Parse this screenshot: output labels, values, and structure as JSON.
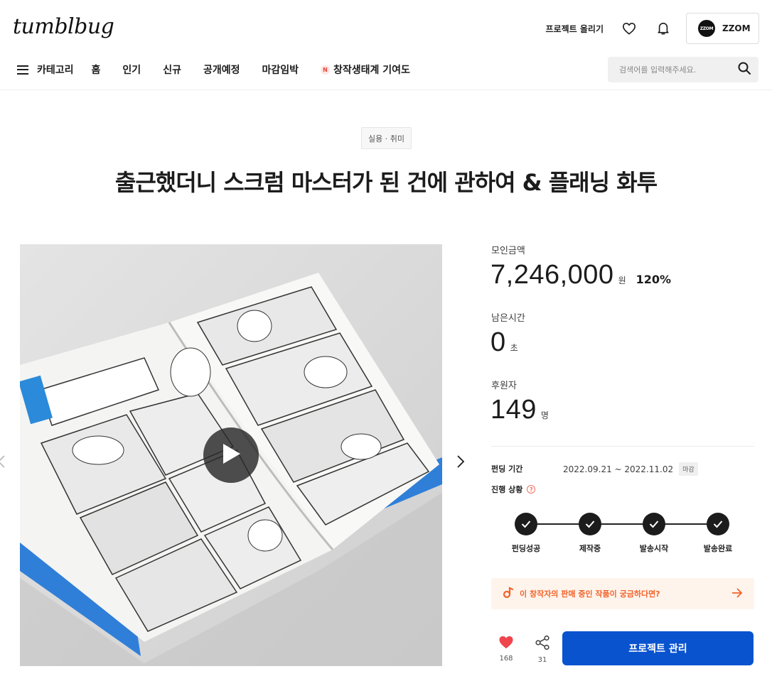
{
  "header": {
    "logo": "tumblbug",
    "upload_label": "프로젝트 올리기",
    "user": {
      "avatar_text": "ZZOM",
      "name": "ZZOM"
    }
  },
  "nav": {
    "category_label": "카테고리",
    "items": [
      "홈",
      "인기",
      "신규",
      "공개예정",
      "마감임박"
    ],
    "special": {
      "badge": "N",
      "label": "창작생태계 기여도"
    },
    "search_placeholder": "검색어를 입력해주세요."
  },
  "project": {
    "category": "실용 · 취미",
    "title": "출근했더니 스크럼 마스터가 된 건에 관하여 & 플래닝 화투"
  },
  "stats": {
    "amount_label": "모인금액",
    "amount": "7,246,000",
    "amount_unit": "원",
    "percent": "120%",
    "time_label": "남은시간",
    "time": "0",
    "time_unit": "초",
    "backers_label": "후원자",
    "backers": "149",
    "backers_unit": "명"
  },
  "funding": {
    "period_label": "펀딩 기간",
    "period": "2022.09.21 ~ 2022.11.02",
    "end_badge": "마감",
    "status_label": "진행 상황",
    "steps": [
      "펀딩성공",
      "제작중",
      "발송시작",
      "발송완료"
    ]
  },
  "creator_banner": "이 창작자의 판매 중인 작품이 궁금하다면?",
  "actions": {
    "likes": "168",
    "shares": "31",
    "manage_label": "프로젝트 관리"
  },
  "colors": {
    "primary": "#0a53cf",
    "accent_orange": "#f2632a",
    "heart": "#f0454d"
  }
}
